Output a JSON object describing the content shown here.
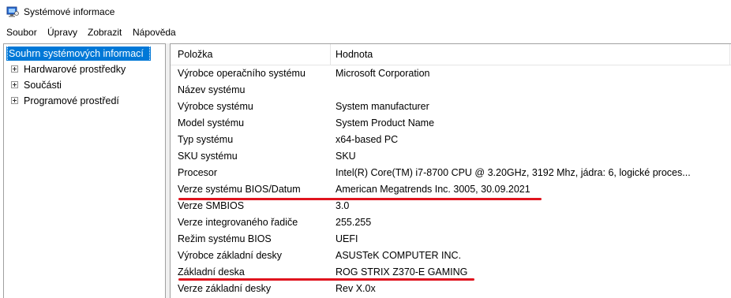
{
  "window": {
    "title": "Systémové informace",
    "icon": "system-information-icon"
  },
  "menu": [
    {
      "label": "Soubor"
    },
    {
      "label": "Úpravy"
    },
    {
      "label": "Zobrazit"
    },
    {
      "label": "Nápověda"
    }
  ],
  "tree": {
    "root": "Souhrn systémových informací",
    "children": [
      {
        "label": "Hardwarové prostředky",
        "icon": "expand-plus-icon"
      },
      {
        "label": "Součásti",
        "icon": "expand-plus-icon"
      },
      {
        "label": "Programové prostředí",
        "icon": "expand-plus-icon"
      }
    ]
  },
  "table": {
    "columns": [
      "Položka",
      "Hodnota"
    ],
    "rows": [
      {
        "item": "Výrobce operačního systému",
        "value": "Microsoft Corporation"
      },
      {
        "item": "Název systému",
        "value": ""
      },
      {
        "item": "Výrobce systému",
        "value": "System manufacturer"
      },
      {
        "item": "Model systému",
        "value": "System Product Name"
      },
      {
        "item": "Typ systému",
        "value": "x64-based PC"
      },
      {
        "item": "SKU systému",
        "value": "SKU"
      },
      {
        "item": "Procesor",
        "value": "Intel(R) Core(TM) i7-8700 CPU @ 3.20GHz, 3192 Mhz, jádra: 6, logické proces..."
      },
      {
        "item": "Verze systému BIOS/Datum",
        "value": "American Megatrends Inc. 3005, 30.09.2021",
        "highlighted": true
      },
      {
        "item": "Verze SMBIOS",
        "value": "3.0"
      },
      {
        "item": "Verze integrovaného řadiče",
        "value": "255.255"
      },
      {
        "item": "Režim systému BIOS",
        "value": "UEFI"
      },
      {
        "item": "Výrobce základní desky",
        "value": "ASUSTeK COMPUTER INC."
      },
      {
        "item": "Základní deska",
        "value": "ROG STRIX Z370-E GAMING",
        "highlighted": true
      },
      {
        "item": "Verze základní desky",
        "value": "Rev X.0x"
      }
    ]
  },
  "colors": {
    "selection": "#0078d7",
    "annotation_underline": "#e0141e"
  }
}
